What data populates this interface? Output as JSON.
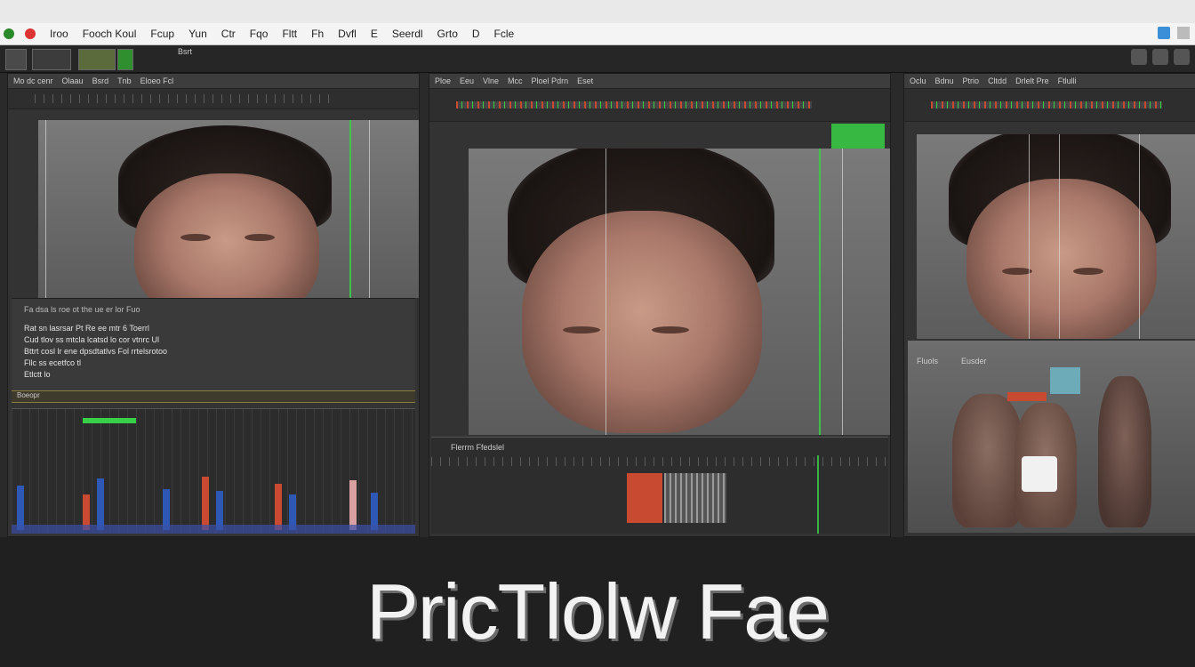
{
  "menubar": {
    "items": [
      "Iroo",
      "Fooch Koul",
      "Fcup",
      "Yun",
      "Ctr",
      "Fqo",
      "Fltt",
      "Fh",
      "Dvfl",
      "E",
      "Seerdl",
      "Grto",
      "D",
      "Fcle"
    ],
    "colors": {
      "bg": "#f4f4f4",
      "icon_red": "#d33",
      "icon_green": "#2a2"
    }
  },
  "toolbar": {
    "tab_label": "Bsrt"
  },
  "panel_left": {
    "header": [
      "Mo dc cenr",
      "Olaau",
      "Bsrd",
      "Tnb",
      "Eloeo Fcl"
    ],
    "caption_bar": "Fa dsa ls roe ot the ue er lor Fuo",
    "text_lines": [
      "Rat sn lasrsar Pt Re ee mtr 6 Toerrl",
      "Cud tlov ss mtcla lcatsd lo cor vtnrc Ul",
      "Bttrt cosl lr ene dpsdtatlvs Fol rrtelsrotoo",
      "Fllc ss ecetfco tl",
      "Etlctt lo"
    ],
    "status": "Boeopr"
  },
  "panel_center": {
    "header": [
      "Ploe",
      "Eeu",
      "Vlne",
      "Mcc",
      "Ploel Pdrn",
      "Eset"
    ],
    "timeline_label": "Flerrm Ffedslel"
  },
  "panel_right": {
    "header": [
      "Oclu",
      "Bdnu",
      "Ptrio",
      "Cltdd",
      "Drlelt Pre",
      "Ftlulli"
    ],
    "sub_label_1": "Fluols",
    "sub_label_2": "Eusder"
  },
  "title": "PricTlolw Fae",
  "accent_colors": {
    "green": "#37d047",
    "red": "#c84a30",
    "blue": "#2f57b5"
  }
}
